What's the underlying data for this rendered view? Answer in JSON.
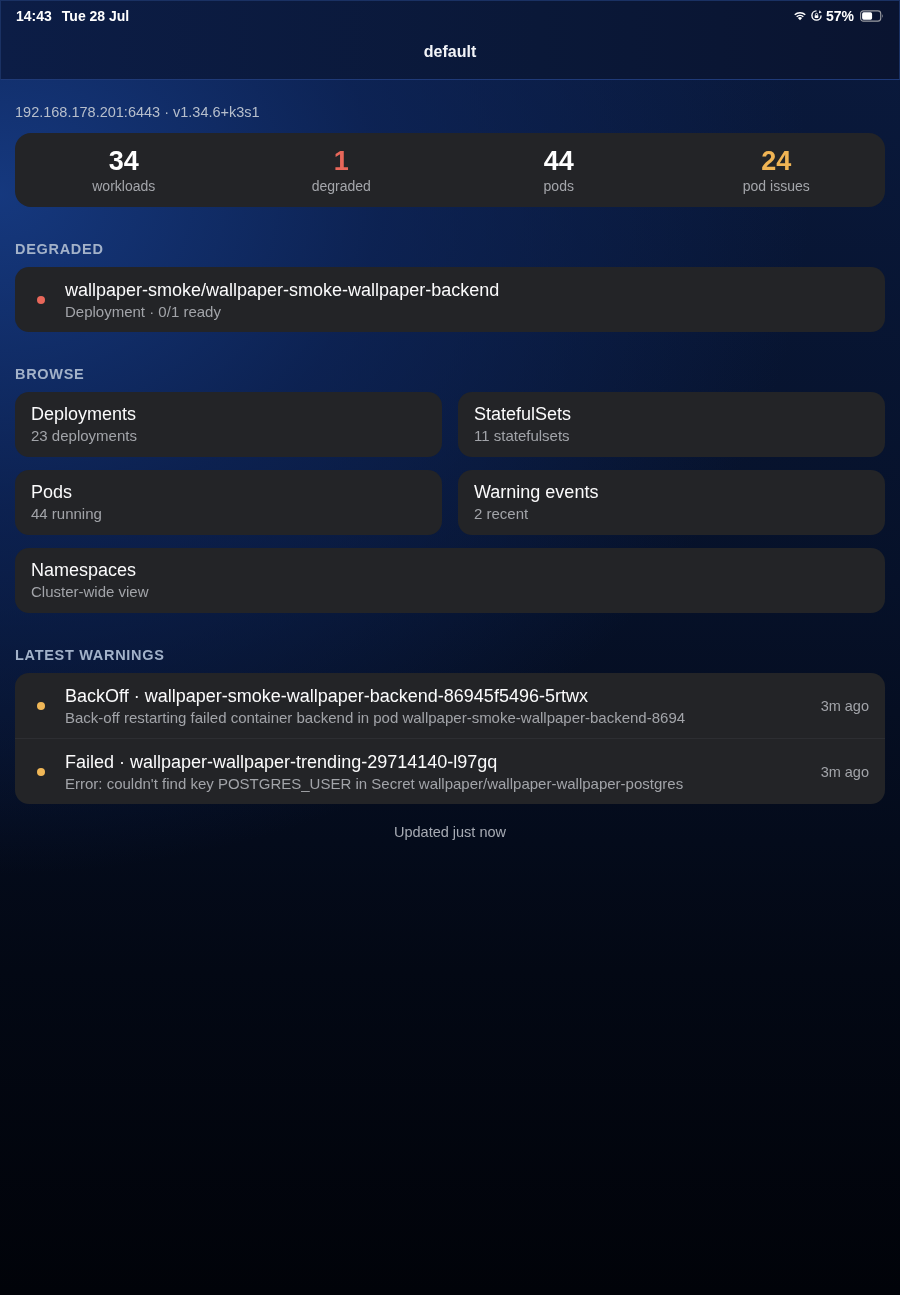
{
  "status_bar": {
    "time": "14:43",
    "date": "Tue 28 Jul",
    "battery_percent": "57%"
  },
  "nav": {
    "title": "default"
  },
  "cluster": {
    "endpoint": "192.168.178.201:6443 · v1.34.6+k3s1"
  },
  "stats": [
    {
      "value": "34",
      "label": "workloads",
      "color": "#ffffff"
    },
    {
      "value": "1",
      "label": "degraded",
      "color": "#e8675a"
    },
    {
      "value": "44",
      "label": "pods",
      "color": "#ffffff"
    },
    {
      "value": "24",
      "label": "pod issues",
      "color": "#f0b454"
    }
  ],
  "degraded": {
    "heading": "DEGRADED",
    "items": [
      {
        "name": "wallpaper-smoke/wallpaper-smoke-wallpaper-backend",
        "detail": "Deployment · 0/1 ready",
        "color": "#e8675a"
      }
    ]
  },
  "browse": {
    "heading": "BROWSE",
    "items": [
      {
        "title": "Deployments",
        "subtitle": "23 deployments"
      },
      {
        "title": "StatefulSets",
        "subtitle": "11 statefulsets"
      },
      {
        "title": "Pods",
        "subtitle": "44 running"
      },
      {
        "title": "Warning events",
        "subtitle": "2 recent"
      },
      {
        "title": "Namespaces",
        "subtitle": "Cluster-wide view"
      }
    ]
  },
  "warnings": {
    "heading": "LATEST WARNINGS",
    "items": [
      {
        "title": "BackOff · wallpaper-smoke-wallpaper-backend-86945f5496-5rtwx",
        "message": "Back-off restarting failed container backend in pod wallpaper-smoke-wallpaper-backend-8694",
        "time": "3m ago",
        "color": "#f0b757"
      },
      {
        "title": "Failed · wallpaper-wallpaper-trending-29714140-l97gq",
        "message": "Error: couldn't find key POSTGRES_USER in Secret wallpaper/wallpaper-wallpaper-postgres",
        "time": "3m ago",
        "color": "#f0b757"
      }
    ]
  },
  "footer": {
    "text": "Updated just now"
  }
}
